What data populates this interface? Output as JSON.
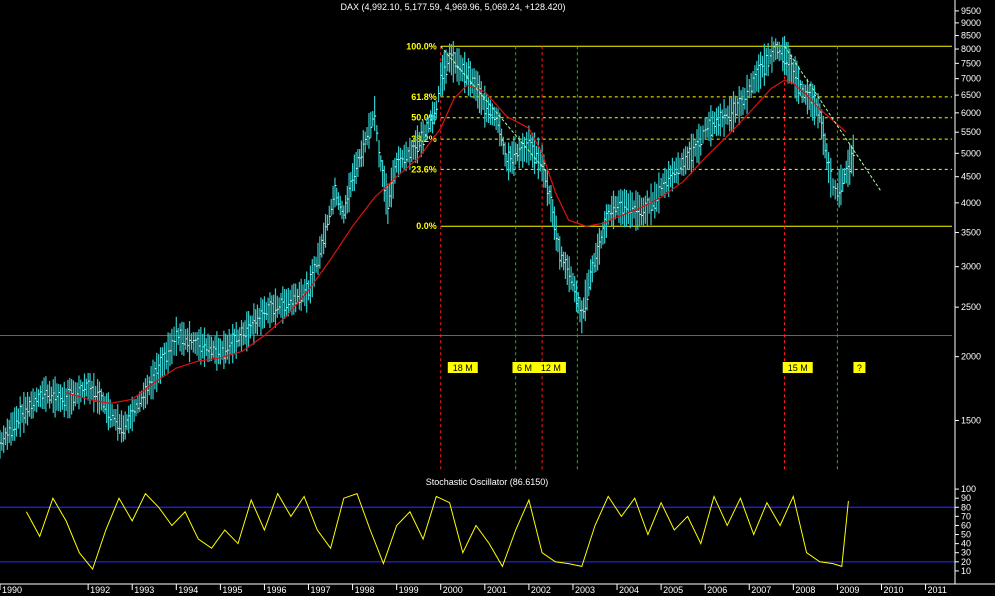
{
  "chart_data": {
    "type": "bar",
    "title": "DAX (4,992.10, 5,177.59, 4,969.96, 5,069.24, +128.420)",
    "scale": "log",
    "ylim": [
      1200,
      9800
    ],
    "xlim": [
      1990.0,
      2011.6
    ],
    "price_ticks": [
      9500,
      9000,
      8500,
      8000,
      7500,
      7000,
      6500,
      6000,
      5500,
      5000,
      4500,
      4000,
      3500,
      3000,
      2500,
      2000,
      1500
    ],
    "year_ticks": [
      {
        "x": 1990.0,
        "label": "1990"
      },
      {
        "x": 1992.0,
        "label": "1992"
      },
      {
        "x": 1993.0,
        "label": "1993"
      },
      {
        "x": 1994.0,
        "label": "1994"
      },
      {
        "x": 1995.0,
        "label": "1995"
      },
      {
        "x": 1996.0,
        "label": "1996"
      },
      {
        "x": 1997.0,
        "label": "1997"
      },
      {
        "x": 1998.0,
        "label": "1998"
      },
      {
        "x": 1999.0,
        "label": "1999"
      },
      {
        "x": 2000.0,
        "label": "2000"
      },
      {
        "x": 2001.0,
        "label": "2001"
      },
      {
        "x": 2002.0,
        "label": "2002"
      },
      {
        "x": 2003.0,
        "label": "2003"
      },
      {
        "x": 2004.0,
        "label": "2004"
      },
      {
        "x": 2005.0,
        "label": "2005"
      },
      {
        "x": 2006.0,
        "label": "2006"
      },
      {
        "x": 2007.0,
        "label": "2007"
      },
      {
        "x": 2008.0,
        "label": "2008"
      },
      {
        "x": 2009.0,
        "label": "2009"
      },
      {
        "x": 2010.0,
        "label": "2010"
      },
      {
        "x": 2011.0,
        "label": "2011"
      }
    ],
    "price_series": {
      "x": [
        1990.0,
        1990.5,
        1991.0,
        1991.5,
        1992.0,
        1992.3,
        1992.5,
        1992.8,
        1993.0,
        1993.3,
        1993.6,
        1993.9,
        1994.0,
        1994.3,
        1994.6,
        1995.0,
        1995.2,
        1995.6,
        1996.0,
        1996.5,
        1997.0,
        1997.3,
        1997.6,
        1997.8,
        1998.0,
        1998.2,
        1998.5,
        1998.6,
        1998.8,
        1999.0,
        1999.3,
        1999.6,
        1999.9,
        2000.0,
        2000.2,
        2000.5,
        2000.8,
        2001.0,
        2001.3,
        2001.5,
        2001.7,
        2001.9,
        2002.0,
        2002.3,
        2002.5,
        2002.7,
        2003.0,
        2003.2,
        2003.4,
        2003.6,
        2003.8,
        2004.0,
        2004.3,
        2004.6,
        2004.9,
        2005.0,
        2005.3,
        2005.6,
        2005.9,
        2006.0,
        2006.3,
        2006.6,
        2006.9,
        2007.0,
        2007.3,
        2007.6,
        2007.8,
        2008.0,
        2008.2,
        2008.4,
        2008.6,
        2008.8,
        2008.9,
        2009.0,
        2009.2,
        2009.4
      ],
      "y": [
        1350,
        1550,
        1700,
        1650,
        1750,
        1650,
        1550,
        1450,
        1550,
        1700,
        1900,
        2100,
        2200,
        2150,
        2100,
        2050,
        2100,
        2250,
        2450,
        2550,
        2700,
        3300,
        4200,
        3800,
        4500,
        5000,
        6000,
        5000,
        4000,
        4800,
        5000,
        5400,
        6100,
        7000,
        7700,
        7300,
        6800,
        6200,
        5800,
        4800,
        5000,
        5100,
        5200,
        4800,
        4000,
        3200,
        2800,
        2400,
        2900,
        3300,
        3800,
        3950,
        3900,
        3850,
        4100,
        4300,
        4600,
        4900,
        5300,
        5600,
        5800,
        6000,
        6400,
        6700,
        7400,
        8000,
        7800,
        7200,
        6600,
        6400,
        6000,
        4700,
        4300,
        4200,
        4600,
        5069
      ]
    },
    "moving_average": {
      "x": [
        1991.5,
        1992.0,
        1992.5,
        1993.0,
        1993.5,
        1994.0,
        1994.5,
        1995.0,
        1995.5,
        1996.0,
        1996.5,
        1997.0,
        1997.5,
        1998.0,
        1998.5,
        1999.0,
        1999.5,
        2000.0,
        2000.3,
        2000.6,
        2001.0,
        2001.5,
        2002.0,
        2002.3,
        2002.6,
        2002.9,
        2003.3,
        2003.7,
        2004.0,
        2004.5,
        2005.0,
        2005.5,
        2006.0,
        2006.5,
        2007.0,
        2007.5,
        2007.8,
        2008.0,
        2008.3,
        2008.6,
        2009.0,
        2009.2
      ],
      "y": [
        1700,
        1650,
        1620,
        1650,
        1780,
        1900,
        1960,
        1990,
        2050,
        2200,
        2400,
        2700,
        3100,
        3600,
        4100,
        4500,
        4900,
        5600,
        6400,
        6800,
        6600,
        5900,
        5600,
        5000,
        4200,
        3700,
        3600,
        3650,
        3750,
        3900,
        4100,
        4400,
        4900,
        5400,
        6000,
        6700,
        6950,
        6850,
        6500,
        6100,
        5700,
        5500
      ]
    },
    "fibonacci_levels": [
      {
        "label": "100.0%",
        "value": 8100,
        "color": "#ffff00",
        "style": "solid"
      },
      {
        "label": "61.8%",
        "value": 6450,
        "color": "#ffff00",
        "style": "dashed"
      },
      {
        "label": "50.0%",
        "value": 5870,
        "color": "#ffff00",
        "style": "dashed"
      },
      {
        "label": "38.2%",
        "value": 5330,
        "color": "#ffff00",
        "style": "dashed"
      },
      {
        "label": "23.6%",
        "value": 4650,
        "color": "#ffff00",
        "style": "dashed"
      },
      {
        "label": "0.0%",
        "value": 3600,
        "color": "#ffff00",
        "style": "solid"
      }
    ],
    "horizontal_support": {
      "value": 2200,
      "color": "#00aa00"
    },
    "trend_lines": [
      {
        "x": [
          2000.0,
          2002.4
        ],
        "y": [
          8100,
          4600
        ]
      },
      {
        "x": [
          2007.8,
          2010.0
        ],
        "y": [
          8100,
          4200
        ]
      }
    ],
    "cycle_lines": [
      {
        "x": 2000.0,
        "color": "#ff2020"
      },
      {
        "x": 2001.7,
        "color": "#00cc00"
      },
      {
        "x": 2002.3,
        "color": "#ff2020"
      },
      {
        "x": 2003.1,
        "color": "#00cc00"
      },
      {
        "x": 2007.8,
        "color": "#ff2020"
      },
      {
        "x": 2009.0,
        "color": "#00cc00"
      }
    ],
    "cycle_labels": [
      {
        "text": "18 M",
        "x": 2000.5
      },
      {
        "text": "6 M",
        "x": 2001.9
      },
      {
        "text": "12 M",
        "x": 2002.5
      },
      {
        "text": "15 M",
        "x": 2008.1
      },
      {
        "text": "?",
        "x": 2009.5
      }
    ],
    "oscillator": {
      "title": "Stochastic Oscillator (86.6150)",
      "ticks": [
        100,
        90,
        80,
        70,
        60,
        50,
        40,
        30,
        20,
        10
      ],
      "upper_band": 80,
      "lower_band": 20,
      "x": [
        1990.6,
        1990.9,
        1991.2,
        1991.5,
        1991.8,
        1992.1,
        1992.4,
        1992.7,
        1993.0,
        1993.3,
        1993.6,
        1993.9,
        1994.2,
        1994.5,
        1994.8,
        1995.1,
        1995.4,
        1995.7,
        1996.0,
        1996.3,
        1996.6,
        1996.9,
        1997.2,
        1997.5,
        1997.8,
        1998.1,
        1998.4,
        1998.7,
        1999.0,
        1999.3,
        1999.6,
        1999.9,
        2000.2,
        2000.5,
        2000.8,
        2001.1,
        2001.4,
        2001.7,
        2002.0,
        2002.3,
        2002.6,
        2002.9,
        2003.2,
        2003.5,
        2003.8,
        2004.1,
        2004.4,
        2004.7,
        2005.0,
        2005.3,
        2005.6,
        2005.9,
        2006.2,
        2006.5,
        2006.8,
        2007.1,
        2007.4,
        2007.7,
        2008.0,
        2008.3,
        2008.6,
        2008.9,
        2009.1,
        2009.25
      ],
      "y": [
        75,
        48,
        90,
        65,
        30,
        12,
        55,
        90,
        65,
        95,
        80,
        60,
        75,
        45,
        35,
        55,
        40,
        88,
        55,
        95,
        70,
        92,
        55,
        35,
        90,
        95,
        55,
        18,
        60,
        75,
        45,
        92,
        85,
        30,
        60,
        40,
        15,
        55,
        88,
        30,
        20,
        18,
        15,
        60,
        92,
        70,
        90,
        50,
        85,
        55,
        70,
        40,
        92,
        60,
        90,
        50,
        85,
        60,
        92,
        30,
        20,
        18,
        15,
        87
      ]
    }
  }
}
